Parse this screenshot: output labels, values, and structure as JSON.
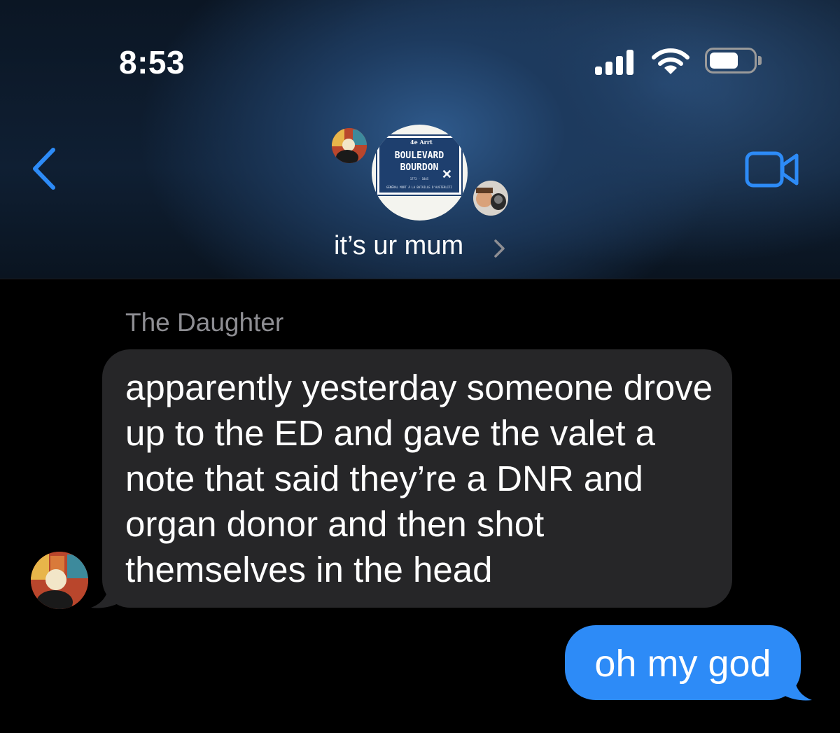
{
  "status_bar": {
    "time": "8:53",
    "signal_icon": "cellular-signal-icon",
    "wifi_icon": "wifi-icon",
    "battery_icon": "battery-icon"
  },
  "nav": {
    "back_icon": "chevron-left-icon",
    "video_icon": "video-camera-icon",
    "accent_color": "#2d8bf7",
    "conversation_name": "it’s ur mum",
    "group_avatar_sign": {
      "line_top": "4e Arrt",
      "line_1": "BOULEVARD",
      "line_2": "BOURDON",
      "line_3": "1773 - 1845",
      "line_4": "GÉNÉRAL MORT À LA BATAILLE D'AUSTERLITZ"
    }
  },
  "thread": {
    "incoming": {
      "sender": "The Daughter",
      "text": "apparently yesterday someone drove up to the ED and gave the valet a note that said they’re a DNR and organ donor and then shot themselves in the head",
      "bubble_color": "#262628"
    },
    "outgoing": {
      "text": "oh my god",
      "bubble_color": "#2d8bf7"
    }
  }
}
